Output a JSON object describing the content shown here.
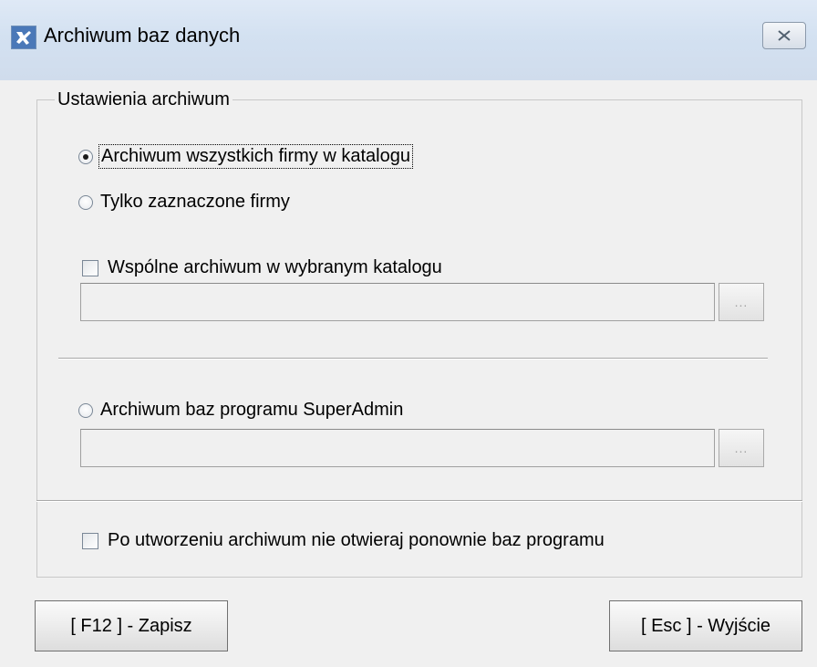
{
  "window": {
    "title": "Archiwum baz danych",
    "close_glyph": "✕"
  },
  "group": {
    "legend": "Ustawienia archiwum"
  },
  "options": {
    "all_companies": {
      "label": "Archiwum wszystkich firmy w katalogu",
      "selected": true
    },
    "selected_companies": {
      "label": "Tylko zaznaczone firmy",
      "selected": false
    },
    "shared_archive": {
      "label": "Wspólne archiwum w wybranym katalogu",
      "checked": false,
      "path_value": "",
      "browse_label": "..."
    },
    "superadmin": {
      "label": "Archiwum baz programu SuperAdmin",
      "selected": false,
      "path_value": "",
      "browse_label": "..."
    },
    "no_reopen": {
      "label": "Po utworzeniu archiwum nie otwieraj ponownie baz programu",
      "checked": false
    }
  },
  "buttons": {
    "save": "[ F12 ] - Zapisz",
    "exit": "[ Esc ] - Wyjście"
  },
  "icons": {
    "app": "app-icon",
    "close": "close-icon",
    "browse": "ellipsis-icon"
  }
}
